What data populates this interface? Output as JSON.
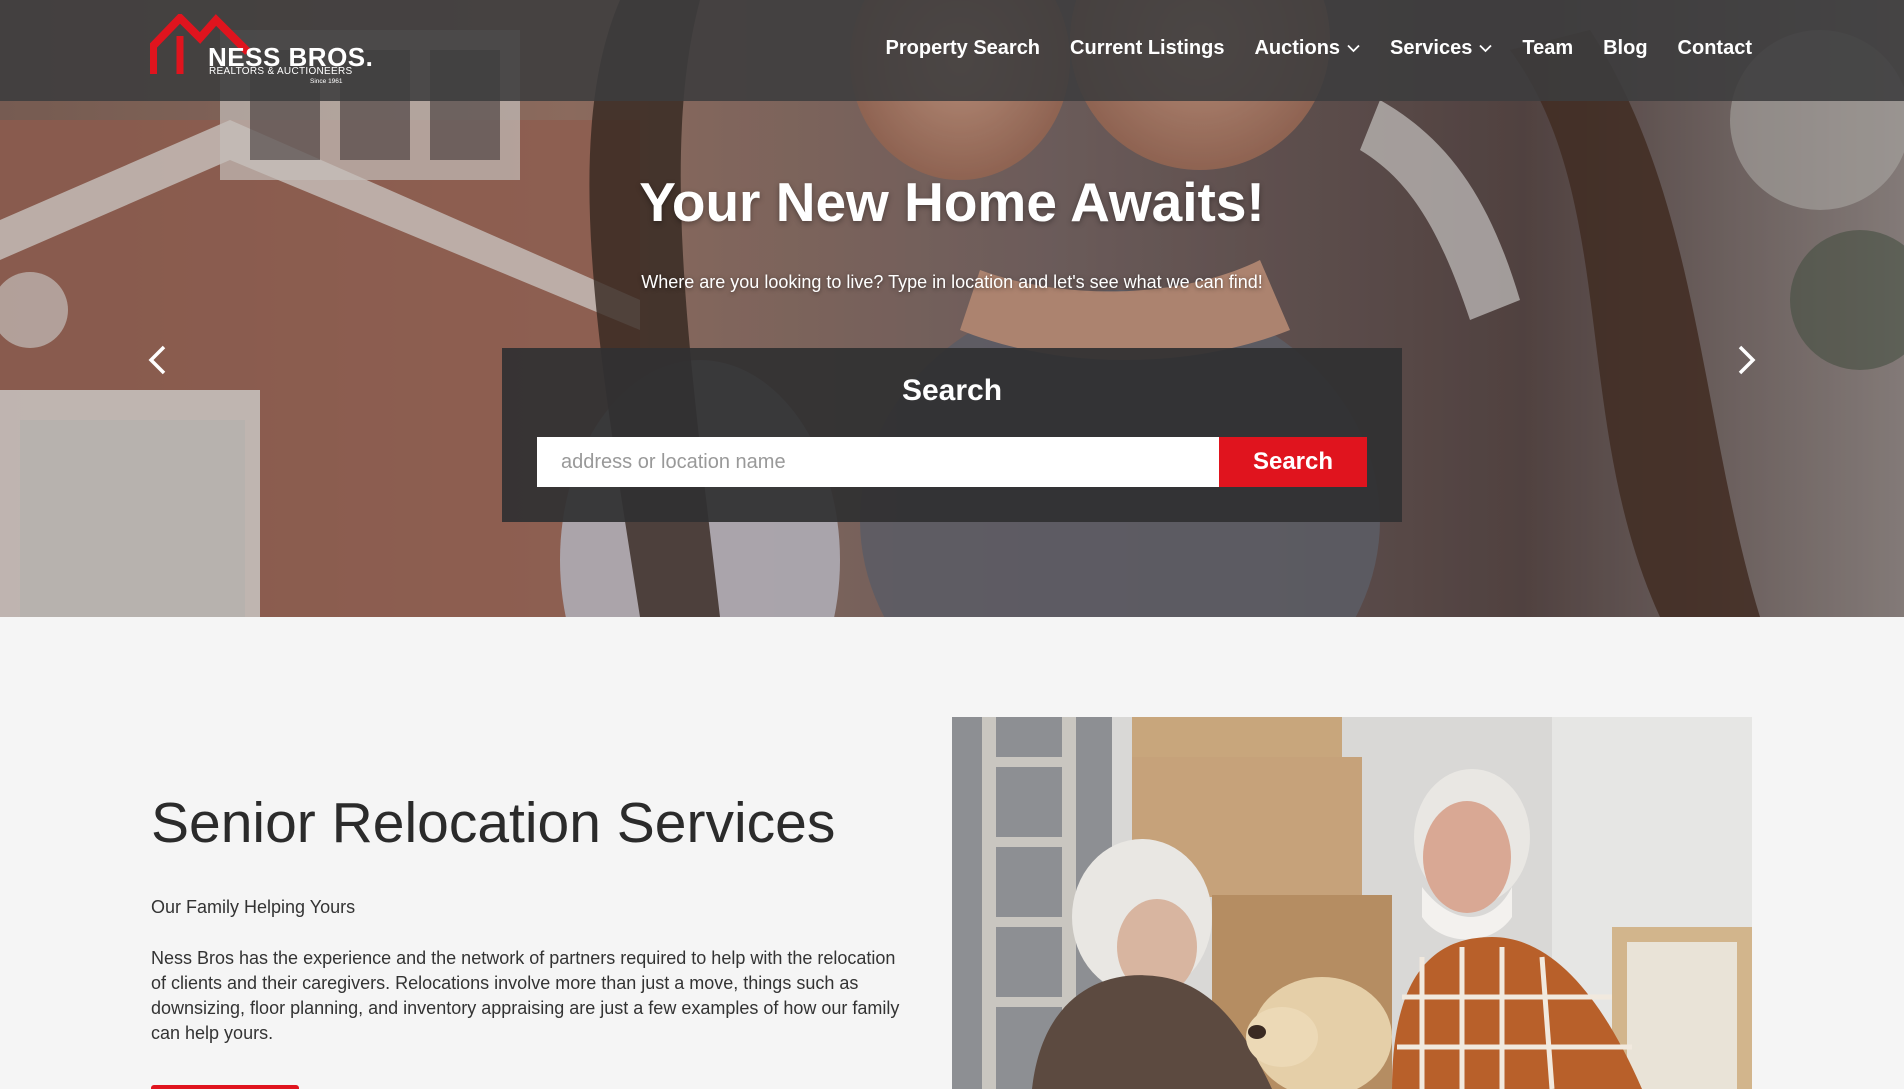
{
  "header": {
    "logo": {
      "brand": "NESS BROS.",
      "tagline": "REALTORS & AUCTIONEERS",
      "since": "Since 1961"
    },
    "nav": [
      {
        "label": "Property Search"
      },
      {
        "label": "Current Listings"
      },
      {
        "label": "Auctions",
        "dropdown": true
      },
      {
        "label": "Services",
        "dropdown": true
      },
      {
        "label": "Team"
      },
      {
        "label": "Blog"
      },
      {
        "label": "Contact"
      }
    ]
  },
  "hero": {
    "title": "Your New Home Awaits!",
    "subtitle": "Where are you looking to live? Type in location  and let's see what we can find!",
    "search": {
      "title": "Search",
      "placeholder": "address or location name",
      "value": "",
      "button_label": "Search"
    },
    "arrows": {
      "prev": "chevron-left-icon",
      "next": "chevron-right-icon"
    }
  },
  "section": {
    "title": "Senior Relocation Services",
    "tagline": "Our Family Helping Yours",
    "body": "Ness Bros has the experience and the network of partners required to help with the relocation of clients and their caregivers. Relocations involve more than just a move, things such as downsizing, floor planning, and inventory appraising are just a few examples of how our family can help yours."
  },
  "colors": {
    "accent": "#e0141e",
    "header_bg": "#3c3c3e",
    "page_bg": "#f5f5f5",
    "text": "#333333"
  }
}
